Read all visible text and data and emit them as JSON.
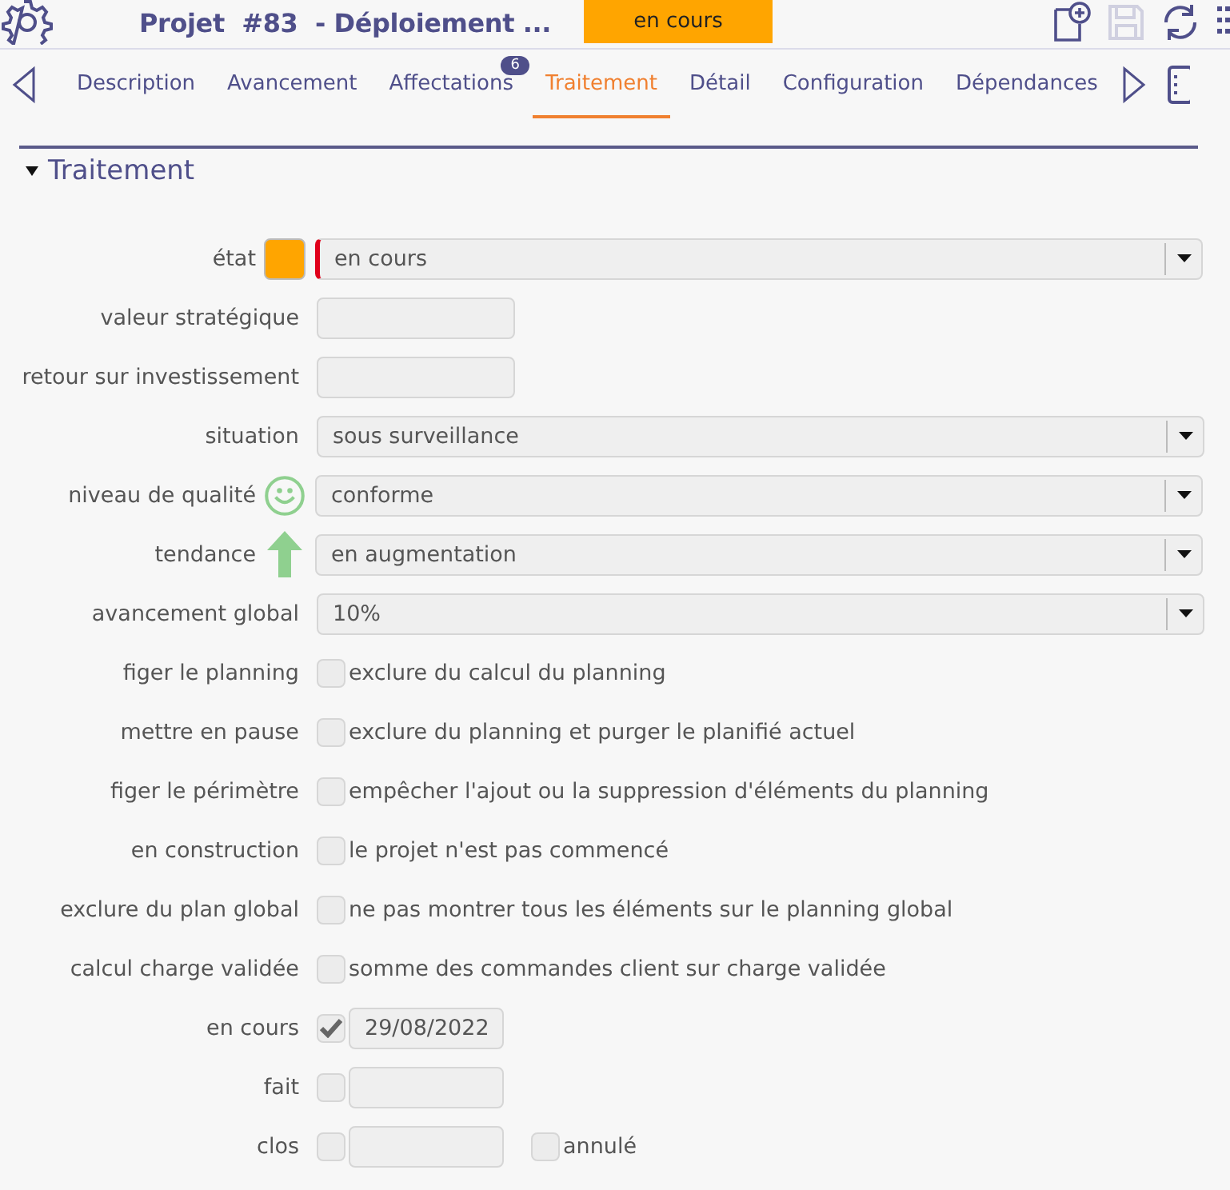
{
  "header": {
    "title": "Projet  #83  - Déploiement ...",
    "status": "en cours",
    "save_disabled": true
  },
  "tabs": [
    {
      "label": "Description",
      "selected": false
    },
    {
      "label": "Avancement",
      "selected": false
    },
    {
      "label": "Affectations",
      "selected": false,
      "badge": "6"
    },
    {
      "label": "Traitement",
      "selected": true
    },
    {
      "label": "Détail",
      "selected": false
    },
    {
      "label": "Configuration",
      "selected": false
    },
    {
      "label": "Dépendances",
      "selected": false
    }
  ],
  "section": {
    "title": "Traitement",
    "expanded": true
  },
  "fields": [
    {
      "kind": "select",
      "label": "état",
      "value": "en cours",
      "required": true,
      "decoration": {
        "kind": "swatch",
        "color": "#ffa500"
      }
    },
    {
      "kind": "text",
      "label": "valeur stratégique",
      "required": false
    },
    {
      "kind": "text",
      "label": "retour sur investissement",
      "required": false
    },
    {
      "kind": "select",
      "label": "situation",
      "value": "sous surveillance",
      "required": false
    },
    {
      "kind": "select",
      "label": "niveau de qualité",
      "value": "conforme",
      "required": false,
      "decoration": {
        "kind": "smiley"
      }
    },
    {
      "kind": "select",
      "label": "tendance",
      "value": "en augmentation",
      "required": false,
      "decoration": {
        "kind": "arrow-up"
      }
    },
    {
      "kind": "select",
      "label": "avancement global",
      "value": "10%",
      "required": false
    },
    {
      "kind": "check",
      "label": "figer le planning",
      "checked": false,
      "text": "exclure du calcul du planning"
    },
    {
      "kind": "check",
      "label": "mettre en pause",
      "checked": false,
      "text": "exclure du planning et purger le planifié actuel"
    },
    {
      "kind": "check",
      "label": "figer le périmètre",
      "checked": false,
      "text": "empêcher l'ajout ou la suppression d'éléments du planning"
    },
    {
      "kind": "check",
      "label": "en construction",
      "checked": false,
      "text": "le projet n'est pas commencé"
    },
    {
      "kind": "check",
      "label": "exclure du plan global",
      "checked": false,
      "text": "ne pas montrer tous les éléments sur le planning global"
    },
    {
      "kind": "check",
      "label": "calcul charge validée",
      "checked": false,
      "text": "somme des commandes client sur charge validée"
    },
    {
      "kind": "date",
      "label": "en cours",
      "checked": true,
      "value": "29/08/2022"
    },
    {
      "kind": "date",
      "label": "fait",
      "checked": false
    },
    {
      "kind": "date",
      "label": "clos",
      "checked": false,
      "extra": {
        "label": "annulé",
        "checked": false
      }
    }
  ]
}
